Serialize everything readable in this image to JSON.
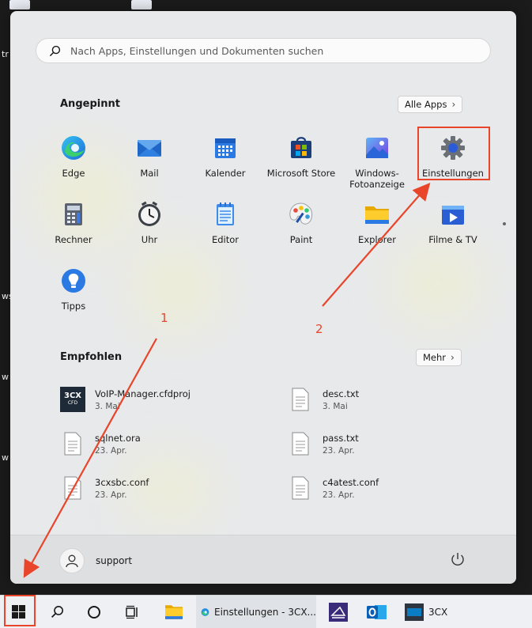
{
  "desktop": {
    "labels": [
      "tr",
      "ws",
      "w",
      "w"
    ]
  },
  "start_menu": {
    "search": {
      "placeholder": "Nach Apps, Einstellungen und Dokumenten suchen"
    },
    "pinned": {
      "title": "Angepinnt",
      "all_apps_label": "Alle Apps",
      "apps": [
        {
          "label": "Edge",
          "icon": "edge-icon"
        },
        {
          "label": "Mail",
          "icon": "mail-icon"
        },
        {
          "label": "Kalender",
          "icon": "calendar-icon"
        },
        {
          "label": "Microsoft Store",
          "icon": "store-icon"
        },
        {
          "label": "Windows-Fotoanzeige",
          "icon": "photos-icon"
        },
        {
          "label": "Einstellungen",
          "icon": "settings-gear-icon"
        },
        {
          "label": "Rechner",
          "icon": "calculator-icon"
        },
        {
          "label": "Uhr",
          "icon": "clock-icon"
        },
        {
          "label": "Editor",
          "icon": "notepad-icon"
        },
        {
          "label": "Paint",
          "icon": "paint-icon"
        },
        {
          "label": "Explorer",
          "icon": "folder-icon"
        },
        {
          "label": "Filme & TV",
          "icon": "movies-icon"
        },
        {
          "label": "Tipps",
          "icon": "tips-icon"
        }
      ]
    },
    "recommended": {
      "title": "Empfohlen",
      "more_label": "Mehr",
      "items": [
        {
          "name": "VoIP-Manager.cfdproj",
          "date": "3. Mai",
          "icon": "3cx-cfd-icon",
          "icon_text": "3CX",
          "icon_sub": "CFD"
        },
        {
          "name": "desc.txt",
          "date": "3. Mai",
          "icon": "text-file-icon"
        },
        {
          "name": "sqlnet.ora",
          "date": "23. Apr.",
          "icon": "file-icon"
        },
        {
          "name": "pass.txt",
          "date": "23. Apr.",
          "icon": "text-file-icon"
        },
        {
          "name": "3cxsbc.conf",
          "date": "23. Apr.",
          "icon": "text-file-icon"
        },
        {
          "name": "c4atest.conf",
          "date": "23. Apr.",
          "icon": "text-file-icon"
        }
      ]
    },
    "footer": {
      "user_name": "support"
    }
  },
  "annotations": {
    "step1": "1",
    "step2": "2",
    "color": "#e8452b"
  },
  "taskbar": {
    "items": [
      {
        "label": "",
        "icon": "windows-start-icon"
      },
      {
        "label": "",
        "icon": "search-icon"
      },
      {
        "label": "",
        "icon": "cortana-icon"
      },
      {
        "label": "",
        "icon": "task-view-icon"
      },
      {
        "label": "",
        "icon": "file-explorer-icon"
      },
      {
        "label": "Einstellungen - 3CX...",
        "icon": "edge-icon"
      },
      {
        "label": "",
        "icon": "sbc-icon"
      },
      {
        "label": "",
        "icon": "outlook-icon"
      },
      {
        "label": "3CX",
        "icon": "3cx-icon"
      }
    ]
  }
}
